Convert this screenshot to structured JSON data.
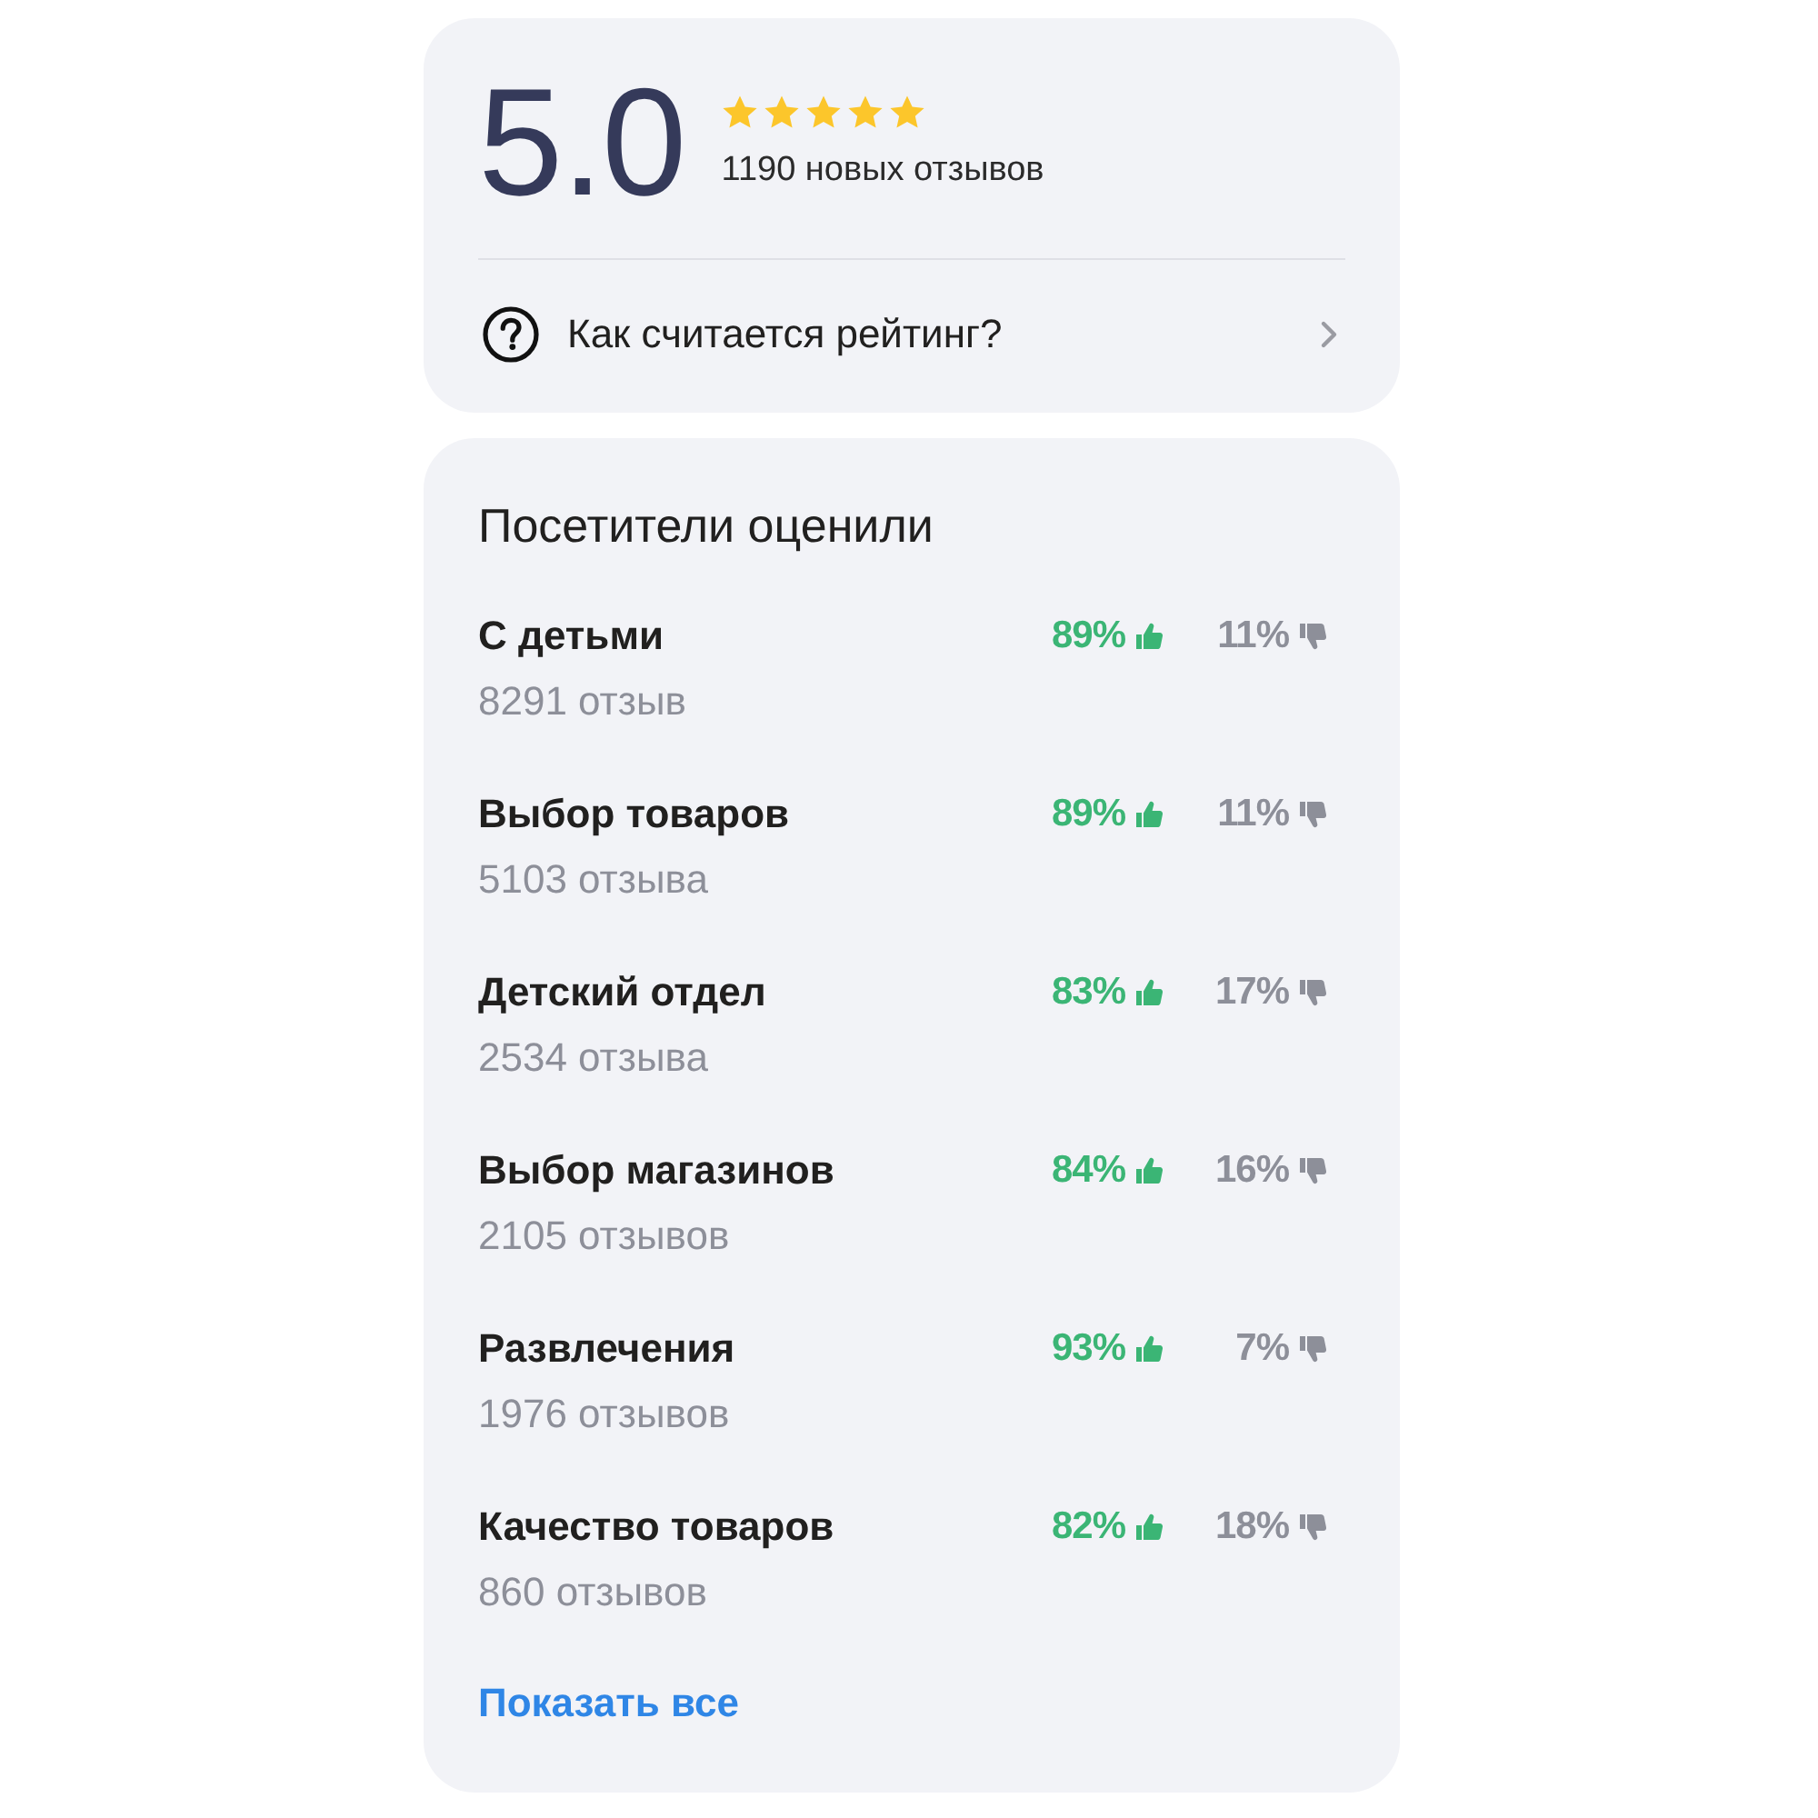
{
  "rating": {
    "value": "5.0",
    "stars": 5,
    "reviews": "1190 новых отзывов",
    "info_link": "Как считается рейтинг?"
  },
  "aspects": {
    "title": "Посетители оценили",
    "items": [
      {
        "name": "С детьми",
        "reviews": "8291 отзыв",
        "positive": "89%",
        "negative": "11%"
      },
      {
        "name": "Выбор товаров",
        "reviews": "5103 отзыва",
        "positive": "89%",
        "negative": "11%"
      },
      {
        "name": "Детский отдел",
        "reviews": "2534 отзыва",
        "positive": "83%",
        "negative": "17%"
      },
      {
        "name": "Выбор магазинов",
        "reviews": "2105 отзывов",
        "positive": "84%",
        "negative": "16%"
      },
      {
        "name": "Развлечения",
        "reviews": "1976 отзывов",
        "positive": "93%",
        "negative": "7%"
      },
      {
        "name": "Качество товаров",
        "reviews": "860 отзывов",
        "positive": "82%",
        "negative": "18%"
      }
    ],
    "show_all": "Показать все"
  }
}
